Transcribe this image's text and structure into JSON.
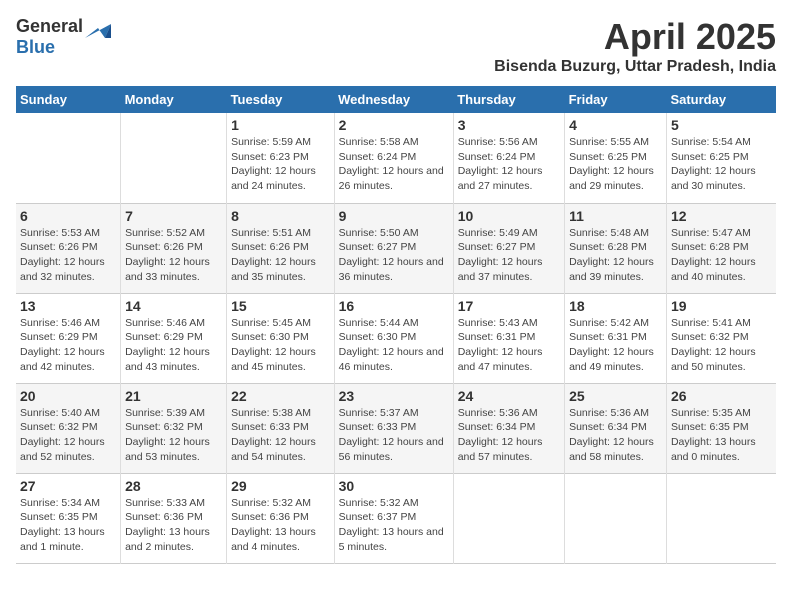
{
  "app": {
    "logo_general": "General",
    "logo_blue": "Blue"
  },
  "header": {
    "month": "April 2025",
    "location": "Bisenda Buzurg, Uttar Pradesh, India"
  },
  "days_of_week": [
    "Sunday",
    "Monday",
    "Tuesday",
    "Wednesday",
    "Thursday",
    "Friday",
    "Saturday"
  ],
  "weeks": [
    [
      {
        "day": "",
        "info": ""
      },
      {
        "day": "",
        "info": ""
      },
      {
        "day": "1",
        "info": "Sunrise: 5:59 AM\nSunset: 6:23 PM\nDaylight: 12 hours and 24 minutes."
      },
      {
        "day": "2",
        "info": "Sunrise: 5:58 AM\nSunset: 6:24 PM\nDaylight: 12 hours and 26 minutes."
      },
      {
        "day": "3",
        "info": "Sunrise: 5:56 AM\nSunset: 6:24 PM\nDaylight: 12 hours and 27 minutes."
      },
      {
        "day": "4",
        "info": "Sunrise: 5:55 AM\nSunset: 6:25 PM\nDaylight: 12 hours and 29 minutes."
      },
      {
        "day": "5",
        "info": "Sunrise: 5:54 AM\nSunset: 6:25 PM\nDaylight: 12 hours and 30 minutes."
      }
    ],
    [
      {
        "day": "6",
        "info": "Sunrise: 5:53 AM\nSunset: 6:26 PM\nDaylight: 12 hours and 32 minutes."
      },
      {
        "day": "7",
        "info": "Sunrise: 5:52 AM\nSunset: 6:26 PM\nDaylight: 12 hours and 33 minutes."
      },
      {
        "day": "8",
        "info": "Sunrise: 5:51 AM\nSunset: 6:26 PM\nDaylight: 12 hours and 35 minutes."
      },
      {
        "day": "9",
        "info": "Sunrise: 5:50 AM\nSunset: 6:27 PM\nDaylight: 12 hours and 36 minutes."
      },
      {
        "day": "10",
        "info": "Sunrise: 5:49 AM\nSunset: 6:27 PM\nDaylight: 12 hours and 37 minutes."
      },
      {
        "day": "11",
        "info": "Sunrise: 5:48 AM\nSunset: 6:28 PM\nDaylight: 12 hours and 39 minutes."
      },
      {
        "day": "12",
        "info": "Sunrise: 5:47 AM\nSunset: 6:28 PM\nDaylight: 12 hours and 40 minutes."
      }
    ],
    [
      {
        "day": "13",
        "info": "Sunrise: 5:46 AM\nSunset: 6:29 PM\nDaylight: 12 hours and 42 minutes."
      },
      {
        "day": "14",
        "info": "Sunrise: 5:46 AM\nSunset: 6:29 PM\nDaylight: 12 hours and 43 minutes."
      },
      {
        "day": "15",
        "info": "Sunrise: 5:45 AM\nSunset: 6:30 PM\nDaylight: 12 hours and 45 minutes."
      },
      {
        "day": "16",
        "info": "Sunrise: 5:44 AM\nSunset: 6:30 PM\nDaylight: 12 hours and 46 minutes."
      },
      {
        "day": "17",
        "info": "Sunrise: 5:43 AM\nSunset: 6:31 PM\nDaylight: 12 hours and 47 minutes."
      },
      {
        "day": "18",
        "info": "Sunrise: 5:42 AM\nSunset: 6:31 PM\nDaylight: 12 hours and 49 minutes."
      },
      {
        "day": "19",
        "info": "Sunrise: 5:41 AM\nSunset: 6:32 PM\nDaylight: 12 hours and 50 minutes."
      }
    ],
    [
      {
        "day": "20",
        "info": "Sunrise: 5:40 AM\nSunset: 6:32 PM\nDaylight: 12 hours and 52 minutes."
      },
      {
        "day": "21",
        "info": "Sunrise: 5:39 AM\nSunset: 6:32 PM\nDaylight: 12 hours and 53 minutes."
      },
      {
        "day": "22",
        "info": "Sunrise: 5:38 AM\nSunset: 6:33 PM\nDaylight: 12 hours and 54 minutes."
      },
      {
        "day": "23",
        "info": "Sunrise: 5:37 AM\nSunset: 6:33 PM\nDaylight: 12 hours and 56 minutes."
      },
      {
        "day": "24",
        "info": "Sunrise: 5:36 AM\nSunset: 6:34 PM\nDaylight: 12 hours and 57 minutes."
      },
      {
        "day": "25",
        "info": "Sunrise: 5:36 AM\nSunset: 6:34 PM\nDaylight: 12 hours and 58 minutes."
      },
      {
        "day": "26",
        "info": "Sunrise: 5:35 AM\nSunset: 6:35 PM\nDaylight: 13 hours and 0 minutes."
      }
    ],
    [
      {
        "day": "27",
        "info": "Sunrise: 5:34 AM\nSunset: 6:35 PM\nDaylight: 13 hours and 1 minute."
      },
      {
        "day": "28",
        "info": "Sunrise: 5:33 AM\nSunset: 6:36 PM\nDaylight: 13 hours and 2 minutes."
      },
      {
        "day": "29",
        "info": "Sunrise: 5:32 AM\nSunset: 6:36 PM\nDaylight: 13 hours and 4 minutes."
      },
      {
        "day": "30",
        "info": "Sunrise: 5:32 AM\nSunset: 6:37 PM\nDaylight: 13 hours and 5 minutes."
      },
      {
        "day": "",
        "info": ""
      },
      {
        "day": "",
        "info": ""
      },
      {
        "day": "",
        "info": ""
      }
    ]
  ]
}
